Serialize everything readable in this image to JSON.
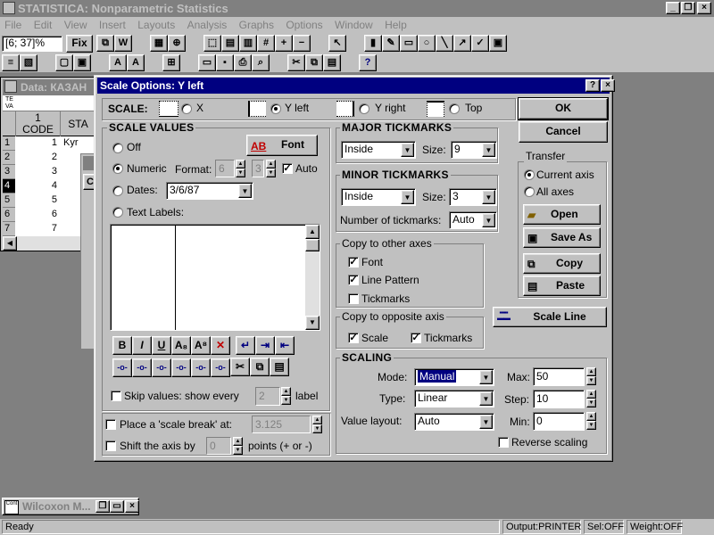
{
  "app": {
    "title": "STATISTICA: Nonparametric Statistics",
    "menu": [
      "File",
      "Edit",
      "View",
      "Insert",
      "Layouts",
      "Analysis",
      "Graphs",
      "Options",
      "Window",
      "Help"
    ],
    "cell_ref": "[6; 37]%",
    "fix_label": "Fix"
  },
  "data_window": {
    "title": "Data: КАЗАН",
    "header_col1_num": "1",
    "header_col1_name": "CODE",
    "header_col2_name": "STA",
    "row_nums": [
      "1",
      "2",
      "3",
      "4",
      "5",
      "6",
      "7"
    ],
    "code_values": [
      "1",
      "2",
      "3",
      "4",
      "5",
      "6",
      "7"
    ],
    "col2_first": "Kyr"
  },
  "minimized": {
    "title": "Wilcoxon M..."
  },
  "status": {
    "ready": "Ready",
    "output": "Output:PRINTER",
    "sel": "Sel:OFF",
    "weight": "Weight:OFF"
  },
  "dialog": {
    "title": "Scale Options:  Y left",
    "scale_label": "SCALE:",
    "scale_options": [
      "X",
      "Y left",
      "Y right",
      "Top"
    ],
    "selected_scale": "Y left",
    "ok": "OK",
    "cancel": "Cancel",
    "scale_values": {
      "title": "SCALE VALUES",
      "off": "Off",
      "font_button": "Font",
      "font_icon_text": "AB",
      "numeric": "Numeric",
      "format_label": "Format:",
      "format_width": "6",
      "format_decimals": "3",
      "auto": "Auto",
      "dates": "Dates:",
      "date_value": "3/6/87",
      "text_labels": "Text Labels:",
      "skip_label": "Skip values: show every",
      "skip_value": "2",
      "skip_suffix": "label"
    },
    "scale_break_label": "Place a 'scale break' at:",
    "scale_break_value": "3.125",
    "shift_label": "Shift the axis by",
    "shift_value": "0",
    "shift_suffix": "points (+ or -)",
    "major_ticks": {
      "title": "MAJOR TICKMARKS",
      "position": "Inside",
      "size_label": "Size:",
      "size": "9"
    },
    "minor_ticks": {
      "title": "MINOR TICKMARKS",
      "position": "Inside",
      "size_label": "Size:",
      "size": "3",
      "number_label": "Number of tickmarks:",
      "number": "Auto"
    },
    "copy_other": {
      "title": "Copy to other axes",
      "font": "Font",
      "line_pattern": "Line Pattern",
      "tickmarks": "Tickmarks"
    },
    "copy_opposite": {
      "title": "Copy to opposite axis",
      "scale": "Scale",
      "tickmarks": "Tickmarks"
    },
    "transfer": {
      "title": "Transfer",
      "current_axis": "Current axis",
      "all_axes": "All axes",
      "open": "Open",
      "save_as": "Save As",
      "copy": "Copy",
      "paste": "Paste"
    },
    "scale_line_button": "Scale Line",
    "scaling": {
      "title": "SCALING",
      "mode_label": "Mode:",
      "mode": "Manual",
      "type_label": "Type:",
      "type": "Linear",
      "value_layout_label": "Value layout:",
      "value_layout": "Auto",
      "max_label": "Max:",
      "max": "50",
      "step_label": "Step:",
      "step": "10",
      "min_label": "Min:",
      "min": "0",
      "reverse_label": "Reverse scaling"
    },
    "format_buttons": [
      "B",
      "I",
      "U"
    ]
  },
  "colors": {
    "title_active": "#000080",
    "face": "#c0c0c0",
    "desktop": "#808080"
  }
}
